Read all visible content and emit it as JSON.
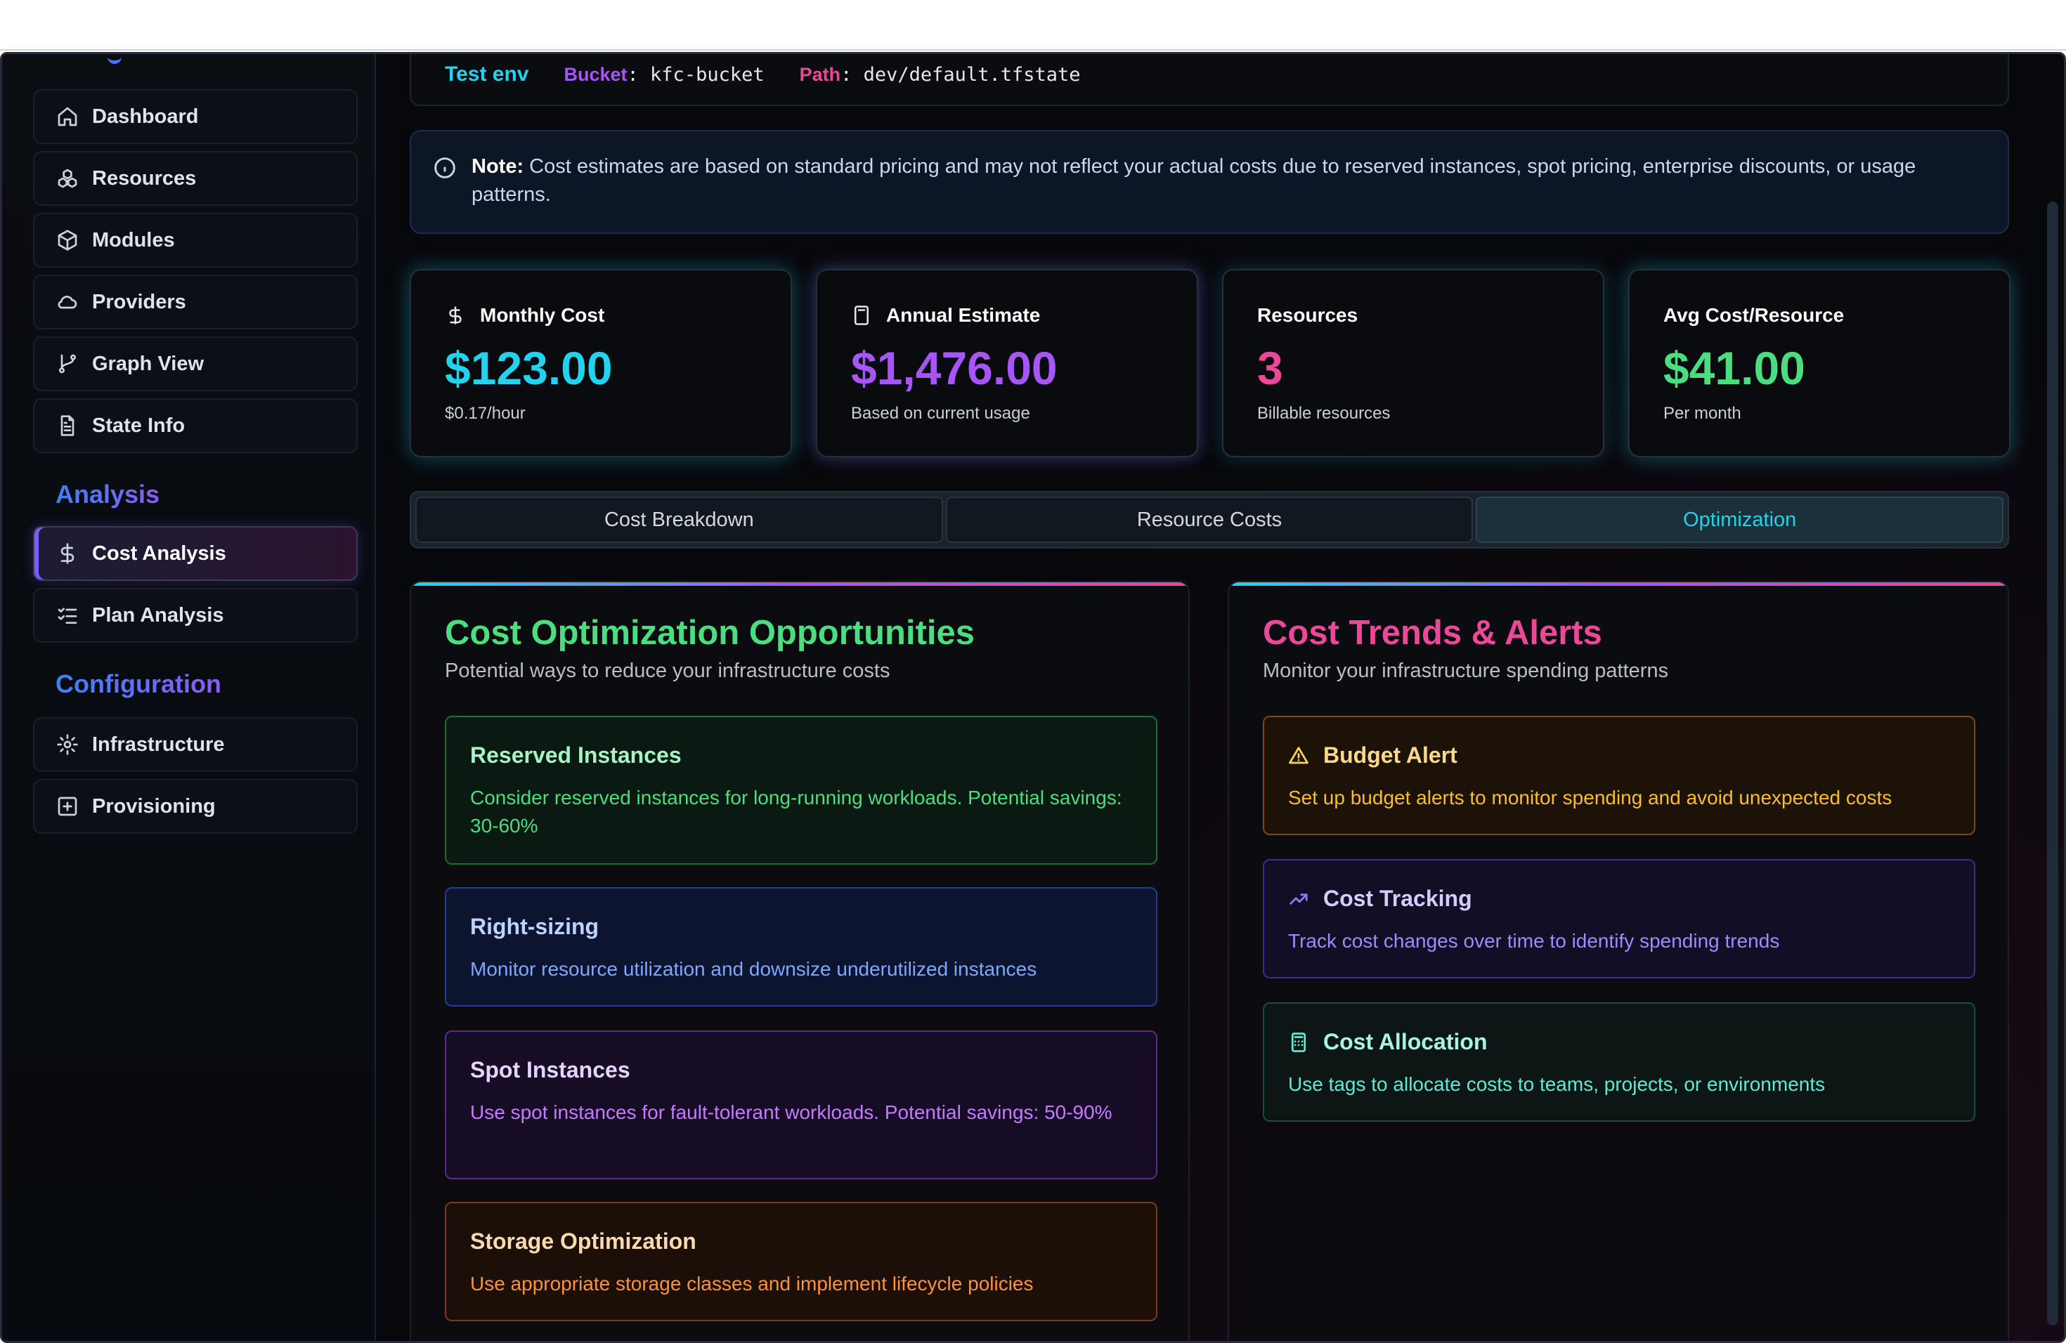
{
  "sidebar": {
    "items": [
      {
        "label": "Dashboard",
        "icon": "home-icon"
      },
      {
        "label": "Resources",
        "icon": "cubes-icon"
      },
      {
        "label": "Modules",
        "icon": "package-icon"
      },
      {
        "label": "Providers",
        "icon": "cloud-icon"
      },
      {
        "label": "Graph View",
        "icon": "git-branch-icon"
      },
      {
        "label": "State Info",
        "icon": "file-text-icon"
      }
    ],
    "analysis_title": "Analysis",
    "analysis_items": [
      {
        "label": "Cost Analysis",
        "icon": "dollar-icon",
        "active": true
      },
      {
        "label": "Plan Analysis",
        "icon": "list-check-icon"
      }
    ],
    "config_title": "Configuration",
    "config_items": [
      {
        "label": "Infrastructure",
        "icon": "gear-icon"
      },
      {
        "label": "Provisioning",
        "icon": "plus-square-icon"
      }
    ]
  },
  "env": {
    "name": "Test env",
    "bucket_key": "Bucket",
    "bucket_value": "kfc-bucket",
    "path_key": "Path",
    "path_value": "dev/default.tfstate"
  },
  "note": {
    "label": "Note:",
    "text": "Cost estimates are based on standard pricing and may not reflect your actual costs due to reserved instances, spot pricing, enterprise discounts, or usage patterns."
  },
  "stats": [
    {
      "label": "Monthly Cost",
      "value": "$123.00",
      "sub": "$0.17/hour",
      "color": "#22d3ee"
    },
    {
      "label": "Annual Estimate",
      "value": "$1,476.00",
      "sub": "Based on current usage",
      "color": "#a855f7"
    },
    {
      "label": "Resources",
      "value": "3",
      "sub": "Billable resources",
      "color": "#ec4899"
    },
    {
      "label": "Avg Cost/Resource",
      "value": "$41.00",
      "sub": "Per month",
      "color": "#4ade80"
    }
  ],
  "tabs": [
    {
      "label": "Cost Breakdown"
    },
    {
      "label": "Resource Costs"
    },
    {
      "label": "Optimization",
      "active": true
    }
  ],
  "optimization": {
    "title": "Cost Optimization Opportunities",
    "subtitle": "Potential ways to reduce your infrastructure costs",
    "cards": [
      {
        "title": "Reserved Instances",
        "desc": "Consider reserved instances for long-running workloads. Potential savings: 30-60%"
      },
      {
        "title": "Right-sizing",
        "desc": "Monitor resource utilization and downsize underutilized instances"
      },
      {
        "title": "Spot Instances",
        "desc": "Use spot instances for fault-tolerant workloads. Potential savings: 50-90%"
      },
      {
        "title": "Storage Optimization",
        "desc": "Use appropriate storage classes and implement lifecycle policies"
      }
    ]
  },
  "trends": {
    "title": "Cost Trends & Alerts",
    "subtitle": "Monitor your infrastructure spending patterns",
    "cards": [
      {
        "title": "Budget Alert",
        "desc": "Set up budget alerts to monitor spending and avoid unexpected costs",
        "icon": "warning-icon"
      },
      {
        "title": "Cost Tracking",
        "desc": "Track cost changes over time to identify spending trends",
        "icon": "trending-up-icon"
      },
      {
        "title": "Cost Allocation",
        "desc": "Use tags to allocate costs to teams, projects, or environments",
        "icon": "calculator-icon"
      }
    ]
  }
}
